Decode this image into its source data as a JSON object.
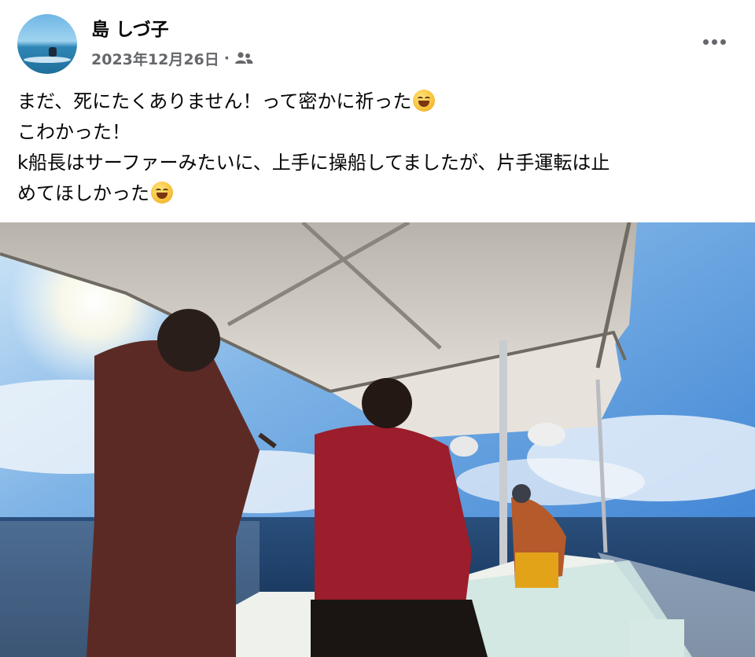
{
  "post": {
    "author": "島 しづ子",
    "date": "2023年12月26日",
    "separator": "·",
    "audience_icon": "friends-icon",
    "more_icon": "more-horizontal-icon",
    "text_lines": [
      "まだ、死にたくありません！って密かに祈った",
      "こわかった！",
      "k船長はサーファーみたいに、上手に操船してましたが、片手運転は止",
      "めてほしかった"
    ],
    "emoji_line_1": "grinning-squinting-face-emoji",
    "emoji_line_4": "grinning-sweat-face-emoji"
  },
  "photo": {
    "subject": "boat-canopy-sea-photo"
  },
  "colors": {
    "text": "#050505",
    "meta": "#65676b",
    "sky": "#3a86d8",
    "sea": "#1d3f6a",
    "canopy": "#d9d4cc",
    "red_jacket": "#9c1d2b"
  }
}
